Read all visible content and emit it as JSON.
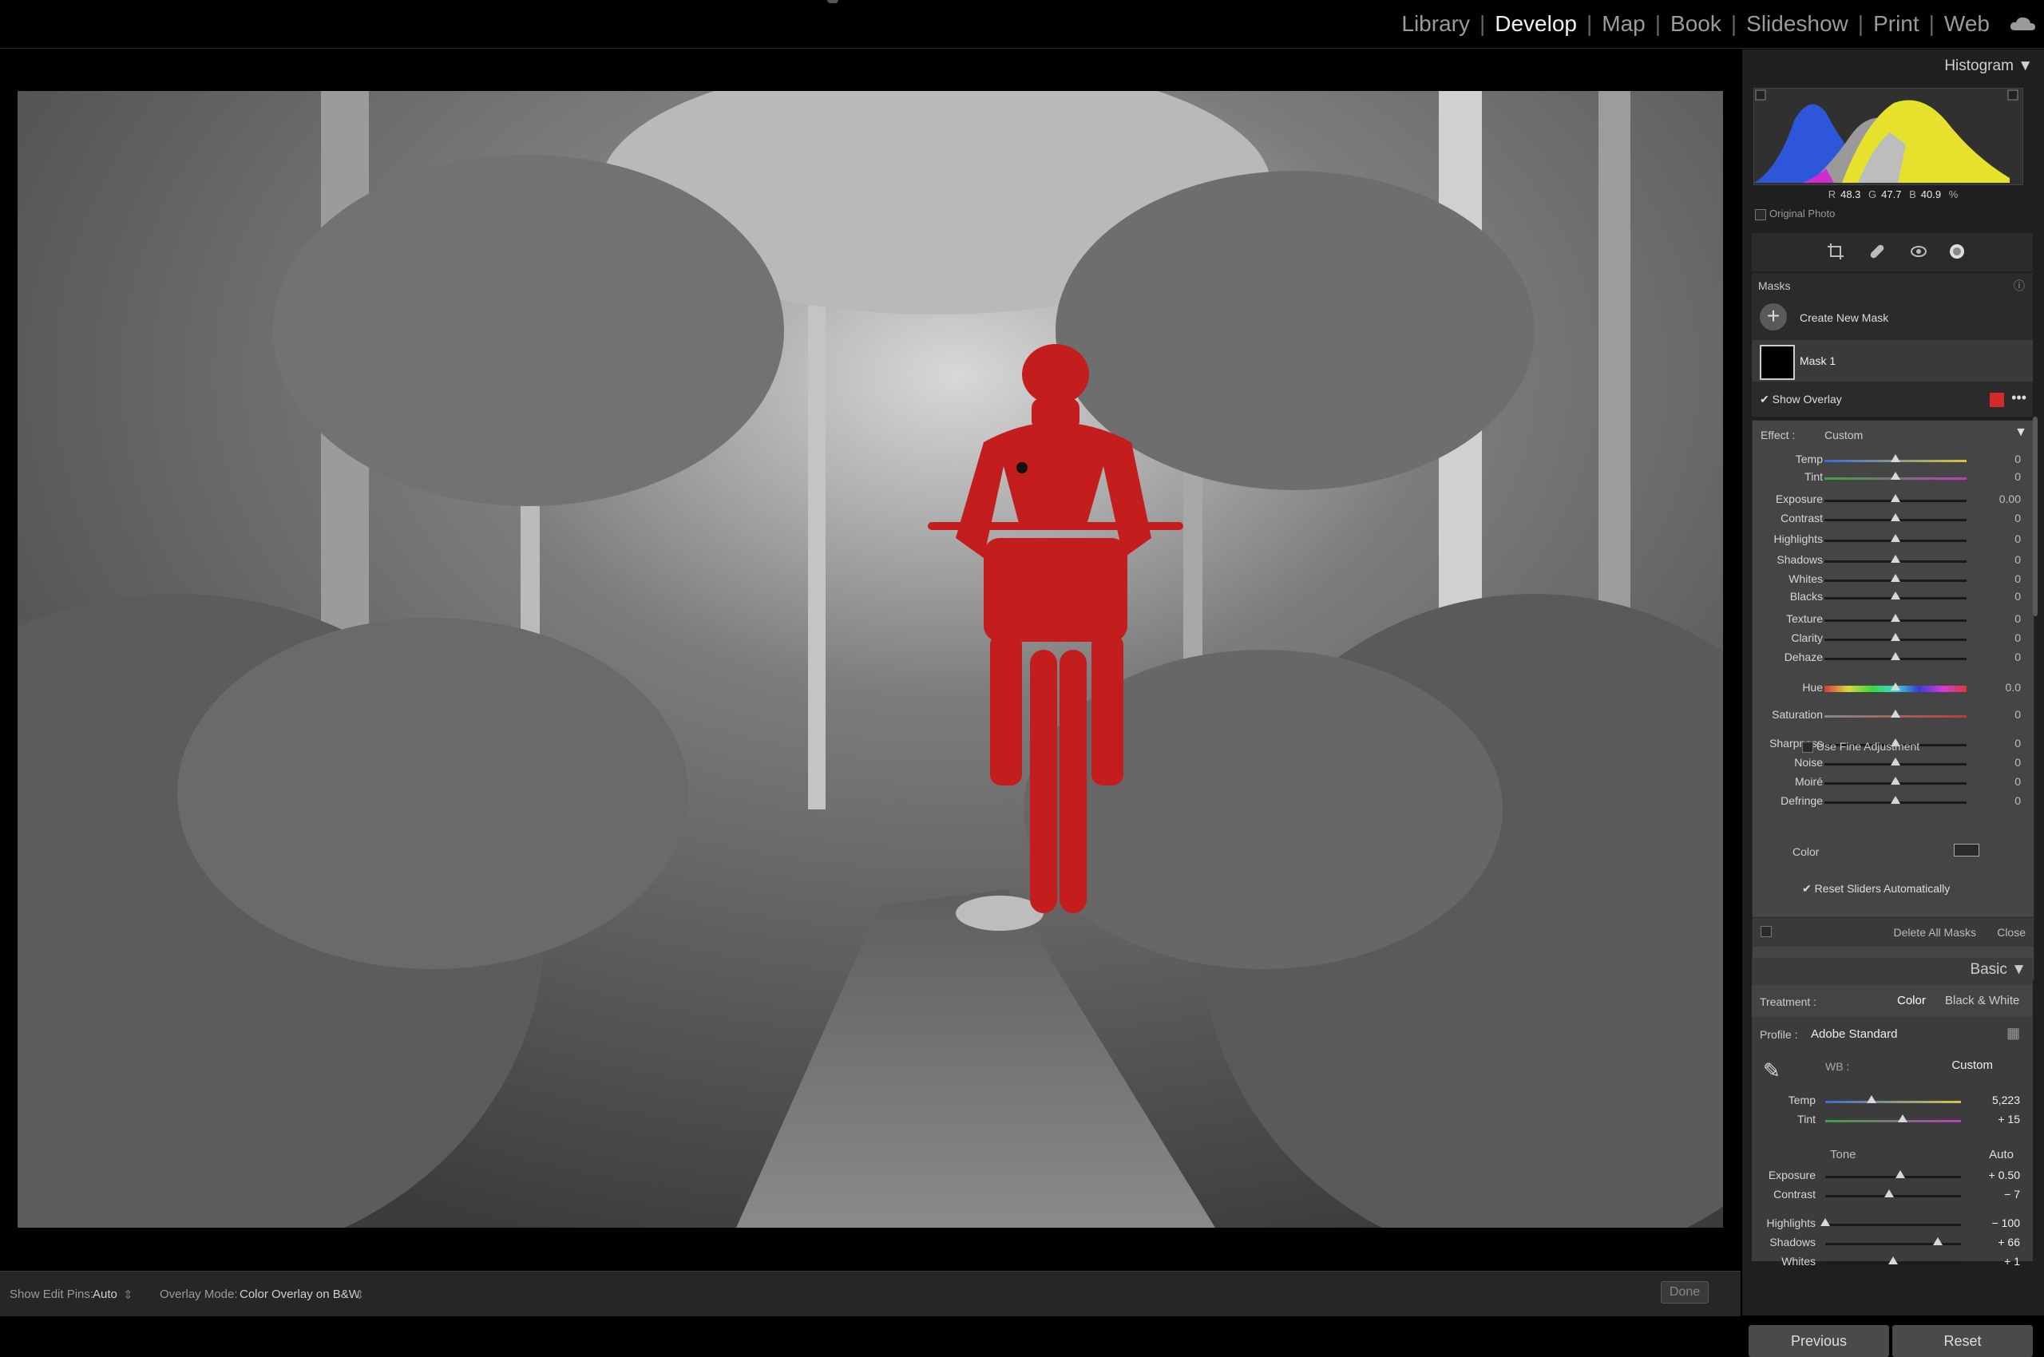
{
  "modules": {
    "items": [
      "Library",
      "Develop",
      "Map",
      "Book",
      "Slideshow",
      "Print",
      "Web"
    ],
    "active": "Develop"
  },
  "histogram": {
    "title": "Histogram",
    "r_label": "R",
    "r_value": "48.3",
    "g_label": "G",
    "g_value": "47.7",
    "b_label": "B",
    "b_value": "40.9",
    "unit": "%",
    "original_photo": "Original Photo"
  },
  "masks": {
    "title": "Masks",
    "create_new": "Create New Mask",
    "mask_name": "Mask 1",
    "show_overlay": "Show Overlay",
    "overlay_color": "#d42a2a"
  },
  "effect": {
    "label": "Effect :",
    "preset": "Custom",
    "sliders": [
      {
        "name": "Temp",
        "value": "0",
        "pos": 0.5
      },
      {
        "name": "Tint",
        "value": "0",
        "pos": 0.5
      },
      {
        "name": "Exposure",
        "value": "0.00",
        "pos": 0.5
      },
      {
        "name": "Contrast",
        "value": "0",
        "pos": 0.5
      },
      {
        "name": "Highlights",
        "value": "0",
        "pos": 0.5
      },
      {
        "name": "Shadows",
        "value": "0",
        "pos": 0.5
      },
      {
        "name": "Whites",
        "value": "0",
        "pos": 0.5
      },
      {
        "name": "Blacks",
        "value": "0",
        "pos": 0.5
      },
      {
        "name": "Texture",
        "value": "0",
        "pos": 0.5
      },
      {
        "name": "Clarity",
        "value": "0",
        "pos": 0.5
      },
      {
        "name": "Dehaze",
        "value": "0",
        "pos": 0.5
      },
      {
        "name": "Hue",
        "value": "0.0",
        "pos": 0.5
      },
      {
        "name": "Saturation",
        "value": "0",
        "pos": 0.5
      },
      {
        "name": "Sharpness",
        "value": "0",
        "pos": 0.5
      },
      {
        "name": "Noise",
        "value": "0",
        "pos": 0.5
      },
      {
        "name": "Moiré",
        "value": "0",
        "pos": 0.5
      },
      {
        "name": "Defringe",
        "value": "0",
        "pos": 0.5
      }
    ],
    "use_fine": "Use Fine Adjustment",
    "color_label": "Color",
    "reset_auto": "Reset Sliders Automatically",
    "delete_all": "Delete All Masks",
    "close": "Close"
  },
  "basic": {
    "title": "Basic",
    "treatment_label": "Treatment :",
    "treatment_color": "Color",
    "treatment_bw": "Black & White",
    "profile_label": "Profile :",
    "profile_value": "Adobe Standard",
    "wb_label": "WB :",
    "wb_value": "Custom",
    "temp_label": "Temp",
    "temp_value": "5,223",
    "temp_pos": 0.34,
    "tint_label": "Tint",
    "tint_value": "+ 15",
    "tint_pos": 0.57,
    "tone_label": "Tone",
    "auto_label": "Auto",
    "tone_sliders": [
      {
        "name": "Exposure",
        "value": "+ 0.50",
        "pos": 0.55
      },
      {
        "name": "Contrast",
        "value": "− 7",
        "pos": 0.47
      },
      {
        "name": "Highlights",
        "value": "− 100",
        "pos": 0.0
      },
      {
        "name": "Shadows",
        "value": "+ 66",
        "pos": 0.83
      },
      {
        "name": "Whites",
        "value": "+ 1",
        "pos": 0.5
      }
    ]
  },
  "bottombar": {
    "edit_pins_label": "Show Edit Pins:",
    "edit_pins_value": "Auto",
    "overlay_mode_label": "Overlay Mode:",
    "overlay_mode_value": "Color Overlay on B&W",
    "done": "Done"
  },
  "footer": {
    "previous": "Previous",
    "reset": "Reset"
  }
}
